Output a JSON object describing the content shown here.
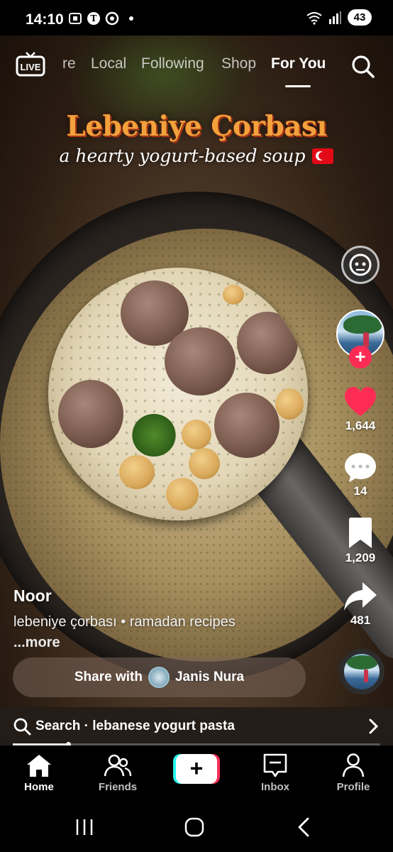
{
  "status_bar": {
    "time": "14:10",
    "battery": "43"
  },
  "top_nav": {
    "live_label": "LIVE",
    "tabs": [
      {
        "label": "re",
        "active": false
      },
      {
        "label": "Local",
        "active": false
      },
      {
        "label": "Following",
        "active": false
      },
      {
        "label": "Shop",
        "active": false
      },
      {
        "label": "For You",
        "active": true
      }
    ]
  },
  "video_overlay": {
    "title": "Lebeniye Çorbası",
    "subtitle": "a hearty yogurt-based soup"
  },
  "rail": {
    "likes": "1,644",
    "comments": "14",
    "saves": "1,209",
    "shares": "481",
    "follow_symbol": "+"
  },
  "post": {
    "author": "Noor",
    "caption": "lebeniye çorbası • ramadan recipes",
    "more": "...more",
    "share_prefix": "Share with",
    "share_name": "Janis Nura",
    "progress": 0.15
  },
  "search_bar": {
    "text": "Search · lebanese yogurt pasta"
  },
  "bottom_nav": {
    "items": [
      {
        "label": "Home",
        "icon": "home-icon",
        "active": true
      },
      {
        "label": "Friends",
        "icon": "friends-icon",
        "active": false
      },
      {
        "label": "+",
        "icon": "plus-icon",
        "active": false
      },
      {
        "label": "Inbox",
        "icon": "inbox-icon",
        "active": false
      },
      {
        "label": "Profile",
        "icon": "profile-icon",
        "active": false
      }
    ]
  },
  "colors": {
    "like": "#fe2c55",
    "accent_cyan": "#25f4ee",
    "title_orange": "#f2a13c"
  }
}
